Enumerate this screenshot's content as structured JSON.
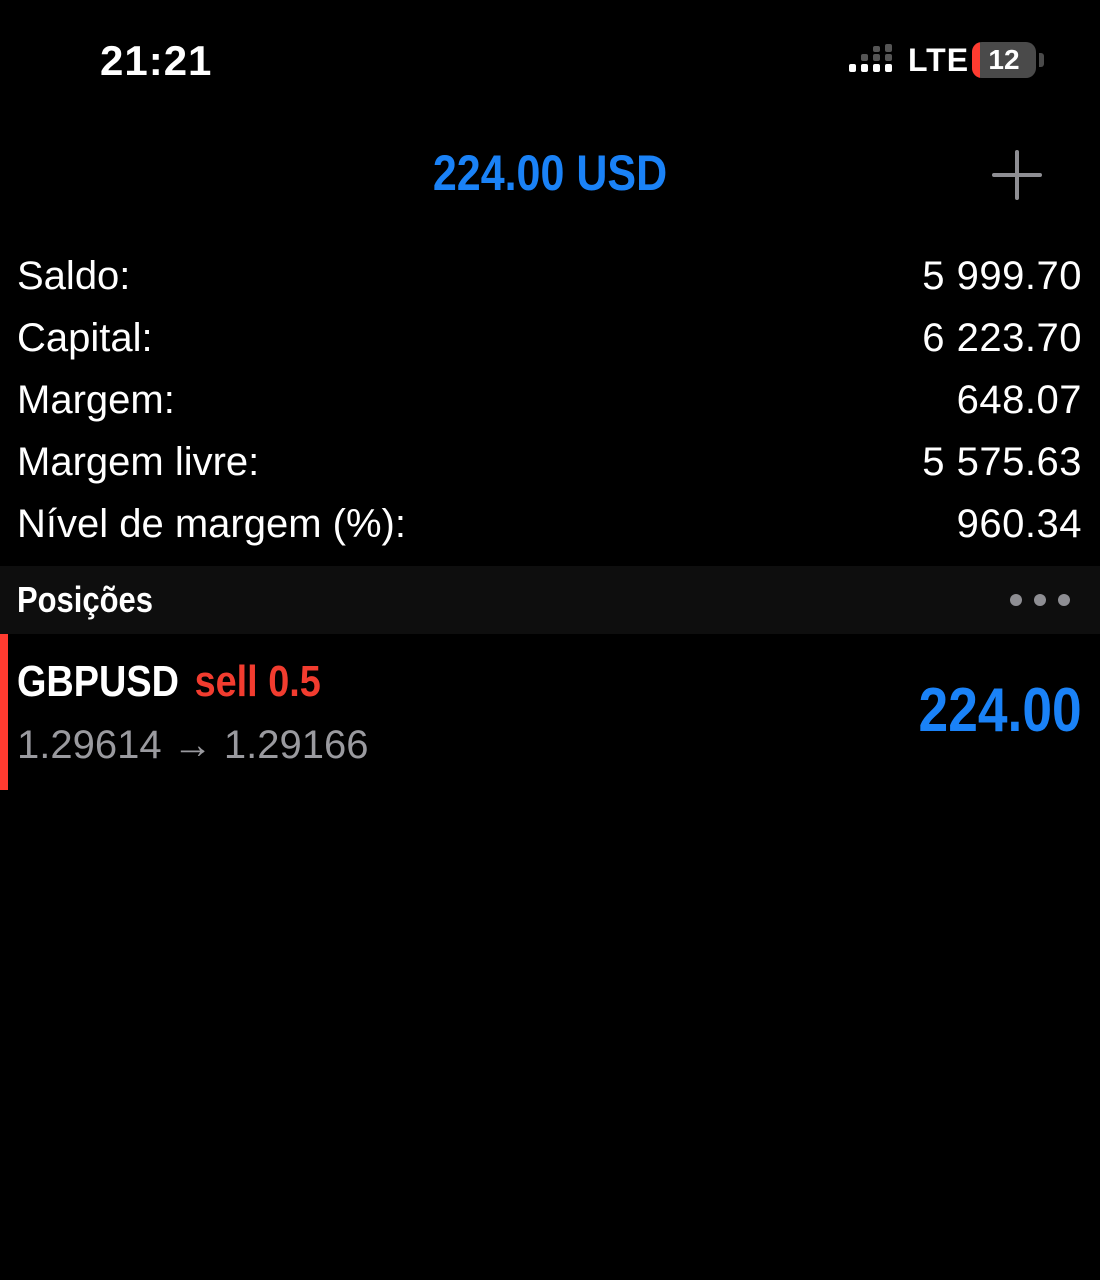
{
  "status_bar": {
    "time": "21:21",
    "network": "LTE",
    "battery_level": "12",
    "battery_fill_fraction": 0.12,
    "signal_icon": "signal-bars-icon"
  },
  "header": {
    "profit": "224.00 USD",
    "add_icon": "plus-icon"
  },
  "summary": {
    "rows": [
      {
        "label": "Saldo:",
        "value": "5 999.70"
      },
      {
        "label": "Capital:",
        "value": "6 223.70"
      },
      {
        "label": "Margem:",
        "value": "648.07"
      },
      {
        "label": "Margem livre:",
        "value": "5 575.63"
      },
      {
        "label": "Nível de margem (%):",
        "value": "960.34"
      }
    ]
  },
  "positions": {
    "title": "Posições",
    "more_icon": "more-dots-icon",
    "items": [
      {
        "symbol": "GBPUSD",
        "side": "sell 0.5",
        "open_price": "1.29614",
        "arrow": "→",
        "current_price": "1.29166",
        "profit": "224.00"
      }
    ]
  },
  "colors": {
    "background": "#000000",
    "accent_blue": "#1a82f7",
    "sell_red": "#f23c2f",
    "secondary_text": "#9a9a9f",
    "section_bg": "#0e0e0e"
  }
}
